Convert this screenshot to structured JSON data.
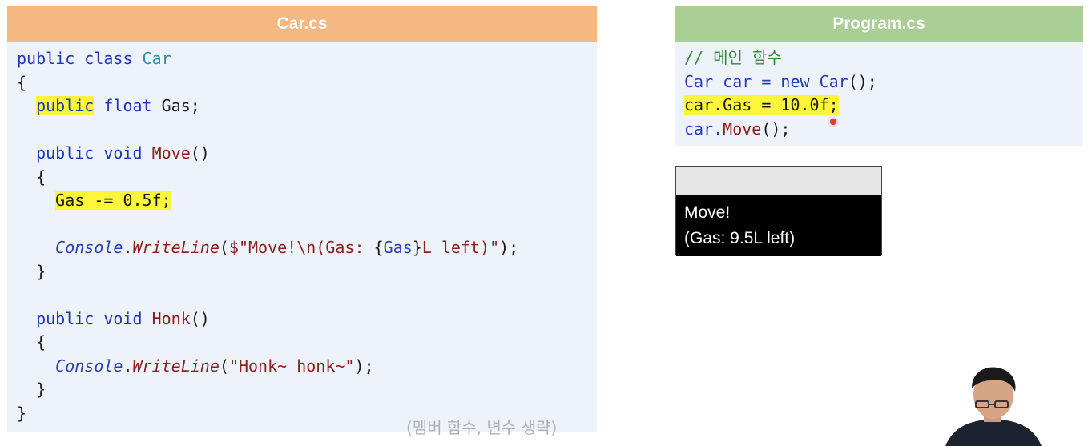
{
  "car_panel": {
    "title": "Car.cs",
    "header_color": "#f6b882",
    "lines": [
      [
        {
          "t": "public class ",
          "c": "kw"
        },
        {
          "t": "Car",
          "c": "type"
        }
      ],
      [
        {
          "t": "{",
          "c": ""
        }
      ],
      [
        {
          "t": "  ",
          "c": ""
        },
        {
          "t": "public",
          "c": "kw hl"
        },
        {
          "t": " float ",
          "c": "kw"
        },
        {
          "t": "Gas;",
          "c": ""
        }
      ],
      [],
      [
        {
          "t": "  public void ",
          "c": "kw"
        },
        {
          "t": "Move",
          "c": "fn"
        },
        {
          "t": "()",
          "c": ""
        }
      ],
      [
        {
          "t": "  {",
          "c": ""
        }
      ],
      [
        {
          "t": "    ",
          "c": ""
        },
        {
          "t": "Gas -= 0.5f;",
          "c": "hl"
        }
      ],
      [],
      [
        {
          "t": "    ",
          "c": ""
        },
        {
          "t": "Console",
          "c": "blue ital"
        },
        {
          "t": ".",
          "c": ""
        },
        {
          "t": "WriteLine",
          "c": "fn ital"
        },
        {
          "t": "(",
          "c": ""
        },
        {
          "t": "$\"Move!\\n(Gas: ",
          "c": "str"
        },
        {
          "t": "{",
          "c": ""
        },
        {
          "t": "Gas",
          "c": "blue"
        },
        {
          "t": "}",
          "c": ""
        },
        {
          "t": "L left)\"",
          "c": "str"
        },
        {
          "t": ");",
          "c": ""
        }
      ],
      [
        {
          "t": "  }",
          "c": ""
        }
      ],
      [],
      [
        {
          "t": "  public void ",
          "c": "kw"
        },
        {
          "t": "Honk",
          "c": "fn"
        },
        {
          "t": "()",
          "c": ""
        }
      ],
      [
        {
          "t": "  {",
          "c": ""
        }
      ],
      [
        {
          "t": "    ",
          "c": ""
        },
        {
          "t": "Console",
          "c": "blue ital"
        },
        {
          "t": ".",
          "c": ""
        },
        {
          "t": "WriteLine",
          "c": "fn ital"
        },
        {
          "t": "(",
          "c": ""
        },
        {
          "t": "\"Honk~ honk~\"",
          "c": "str"
        },
        {
          "t": ");",
          "c": ""
        }
      ],
      [
        {
          "t": "  }",
          "c": ""
        }
      ],
      [
        {
          "t": "}",
          "c": ""
        }
      ]
    ],
    "hint": "(멤버 함수, 변수 생략)"
  },
  "program_panel": {
    "title": "Program.cs",
    "header_color": "#a9cf95",
    "lines": [
      [
        {
          "t": "// 메인 함수",
          "c": "cmt"
        }
      ],
      [
        {
          "t": "Car",
          "c": "blue"
        },
        {
          "t": " car = ",
          "c": "blue"
        },
        {
          "t": "new ",
          "c": "kw"
        },
        {
          "t": "Car",
          "c": "blue"
        },
        {
          "t": "();",
          "c": ""
        }
      ],
      [
        {
          "t": "car.Gas = 10.0f;",
          "c": "hl"
        }
      ],
      [
        {
          "t": "car.",
          "c": "blue"
        },
        {
          "t": "Move",
          "c": "fn"
        },
        {
          "t": "();",
          "c": ""
        }
      ]
    ]
  },
  "console": {
    "lines": [
      "Move!",
      "(Gas: 9.5L left)"
    ]
  }
}
